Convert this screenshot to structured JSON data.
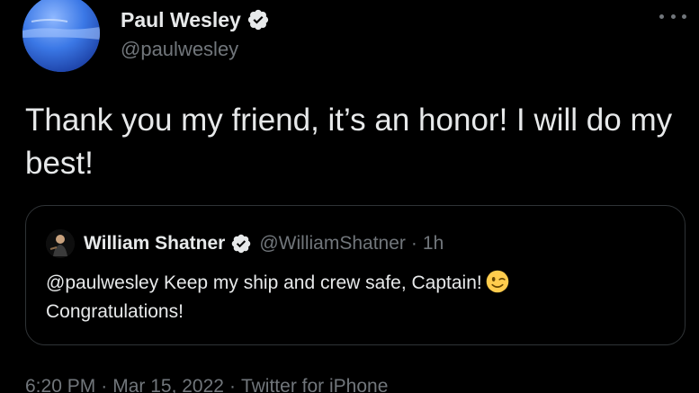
{
  "tweet": {
    "author_name": "Paul Wesley",
    "author_handle": "@paulwesley",
    "text": "Thank you my friend, it’s an honor! I will do my best!",
    "more_icon": "more-dots-icon"
  },
  "quoted_tweet": {
    "author_name": "William Shatner",
    "author_handle": "@WilliamShatner",
    "separator": "·",
    "time": "1h",
    "text": "@paulwesley Keep my ship and crew safe, Captain!",
    "text_line2": "Congratulations!",
    "emoji": "winking-face-emoji"
  },
  "meta": {
    "time": "6:20 PM",
    "separator": "·",
    "date": "Mar 15, 2022",
    "source": "Twitter for iPhone"
  },
  "colors": {
    "background": "#000000",
    "text": "#e7e9ea",
    "secondary": "#71767b",
    "border": "#2f3336",
    "verified_badge": "#e7e9ea"
  }
}
